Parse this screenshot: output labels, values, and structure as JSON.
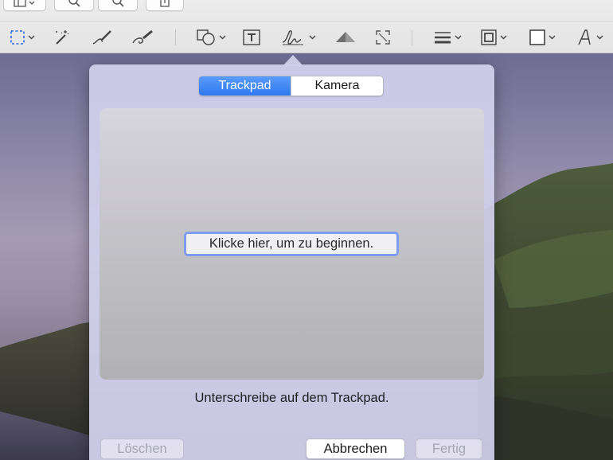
{
  "toolbar": {
    "top_buttons": [
      {
        "icon": "sidebar-view-icon"
      },
      {
        "icon": "zoom-out-icon"
      },
      {
        "icon": "zoom-in-icon"
      },
      {
        "icon": "share-icon"
      }
    ],
    "tools": [
      {
        "icon": "rectangular-selection-icon"
      },
      {
        "icon": "instant-alpha-icon"
      },
      {
        "icon": "sketch-icon"
      },
      {
        "icon": "draw-icon"
      },
      {
        "icon": "shapes-icon"
      },
      {
        "icon": "text-icon"
      },
      {
        "icon": "signature-icon"
      },
      {
        "icon": "adjust-color-icon"
      },
      {
        "icon": "adjust-size-icon"
      },
      {
        "icon": "shape-style-icon"
      },
      {
        "icon": "border-color-icon"
      },
      {
        "icon": "fill-color-icon"
      },
      {
        "icon": "text-style-icon"
      }
    ]
  },
  "signature_popover": {
    "tabs": [
      {
        "label": "Trackpad",
        "active": true
      },
      {
        "label": "Kamera",
        "active": false
      }
    ],
    "start_button": "Klicke hier, um zu beginnen.",
    "hint": "Unterschreibe auf dem Trackpad.",
    "buttons": {
      "clear": "Löschen",
      "cancel": "Abbrechen",
      "done": "Fertig"
    }
  },
  "colors": {
    "accent": "#2f78f0",
    "focus_ring": "#7f9cf0",
    "selection_tool": "#2f6cf0"
  }
}
